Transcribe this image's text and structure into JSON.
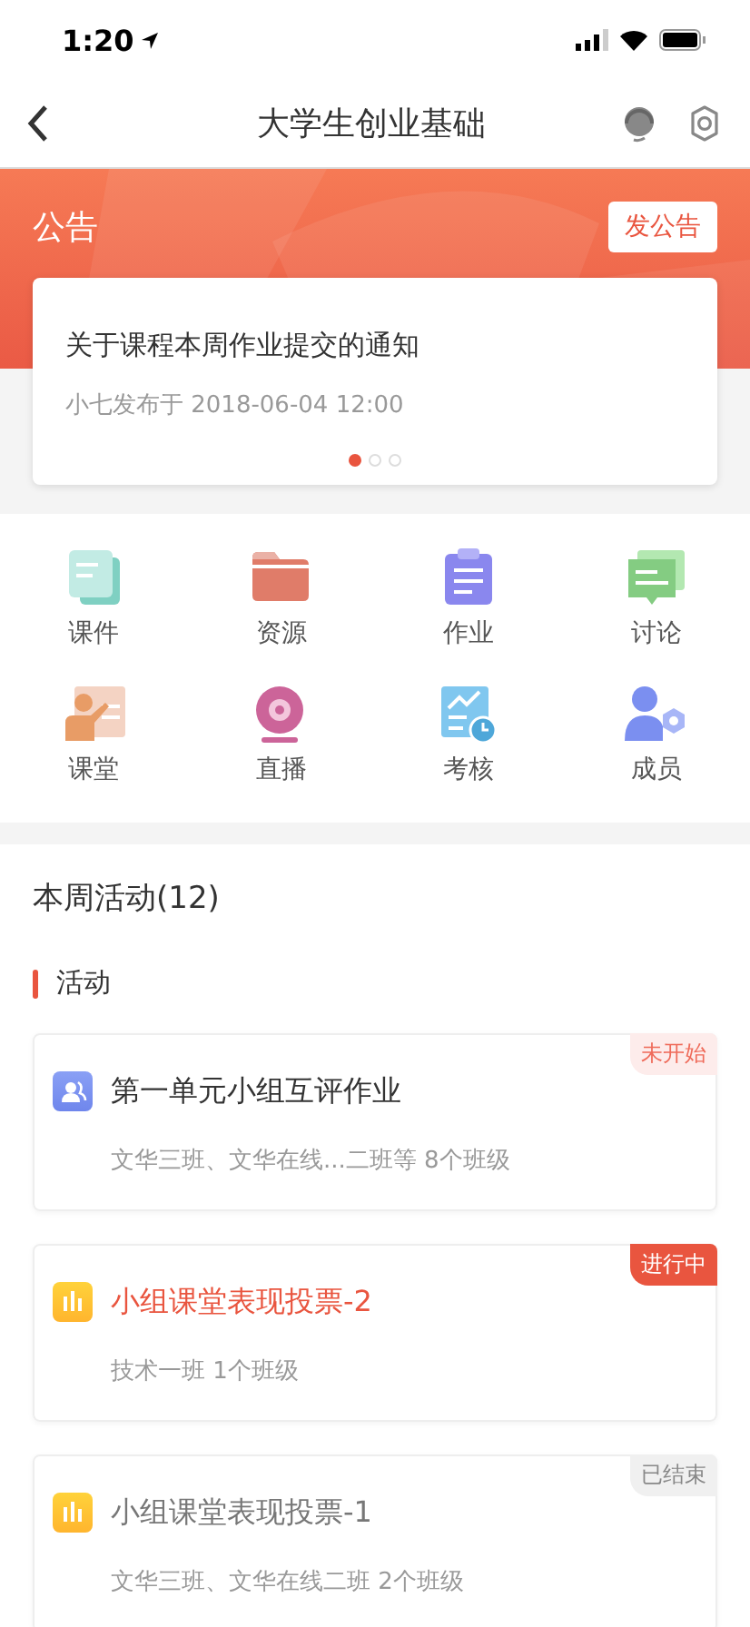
{
  "status_bar": {
    "time": "1:20"
  },
  "nav": {
    "title": "大学生创业基础"
  },
  "announcement": {
    "heading": "公告",
    "button": "发公告",
    "title": "关于课程本周作业提交的通知",
    "meta": "小七发布于 2018-06-04 12:00",
    "pages": [
      {
        "selected": true
      },
      {
        "selected": false
      },
      {
        "selected": false
      }
    ]
  },
  "menu": [
    {
      "kind": "courseware",
      "label": "课件"
    },
    {
      "kind": "resource",
      "label": "资源"
    },
    {
      "kind": "homework",
      "label": "作业"
    },
    {
      "kind": "discussion",
      "label": "讨论"
    },
    {
      "kind": "classroom",
      "label": "课堂"
    },
    {
      "kind": "live",
      "label": "直播"
    },
    {
      "kind": "assessment",
      "label": "考核"
    },
    {
      "kind": "members",
      "label": "成员"
    }
  ],
  "week": {
    "title": "本周活动(12)",
    "section": "活动"
  },
  "activities": [
    {
      "kind": "group",
      "status": {
        "kind": "pending",
        "label": "未开始"
      },
      "title": "第一单元小组互评作业",
      "classes": "文华三班、文华在线...二班等 8个班级"
    },
    {
      "kind": "vote",
      "status": {
        "kind": "ongoing",
        "label": "进行中"
      },
      "title": "小组课堂表现投票-2",
      "classes": "技术一班 1个班级"
    },
    {
      "kind": "vote",
      "status": {
        "kind": "ended",
        "label": "已结束"
      },
      "title": "小组课堂表现投票-1",
      "classes": "文华三班、文华在线二班 2个班级"
    }
  ]
}
